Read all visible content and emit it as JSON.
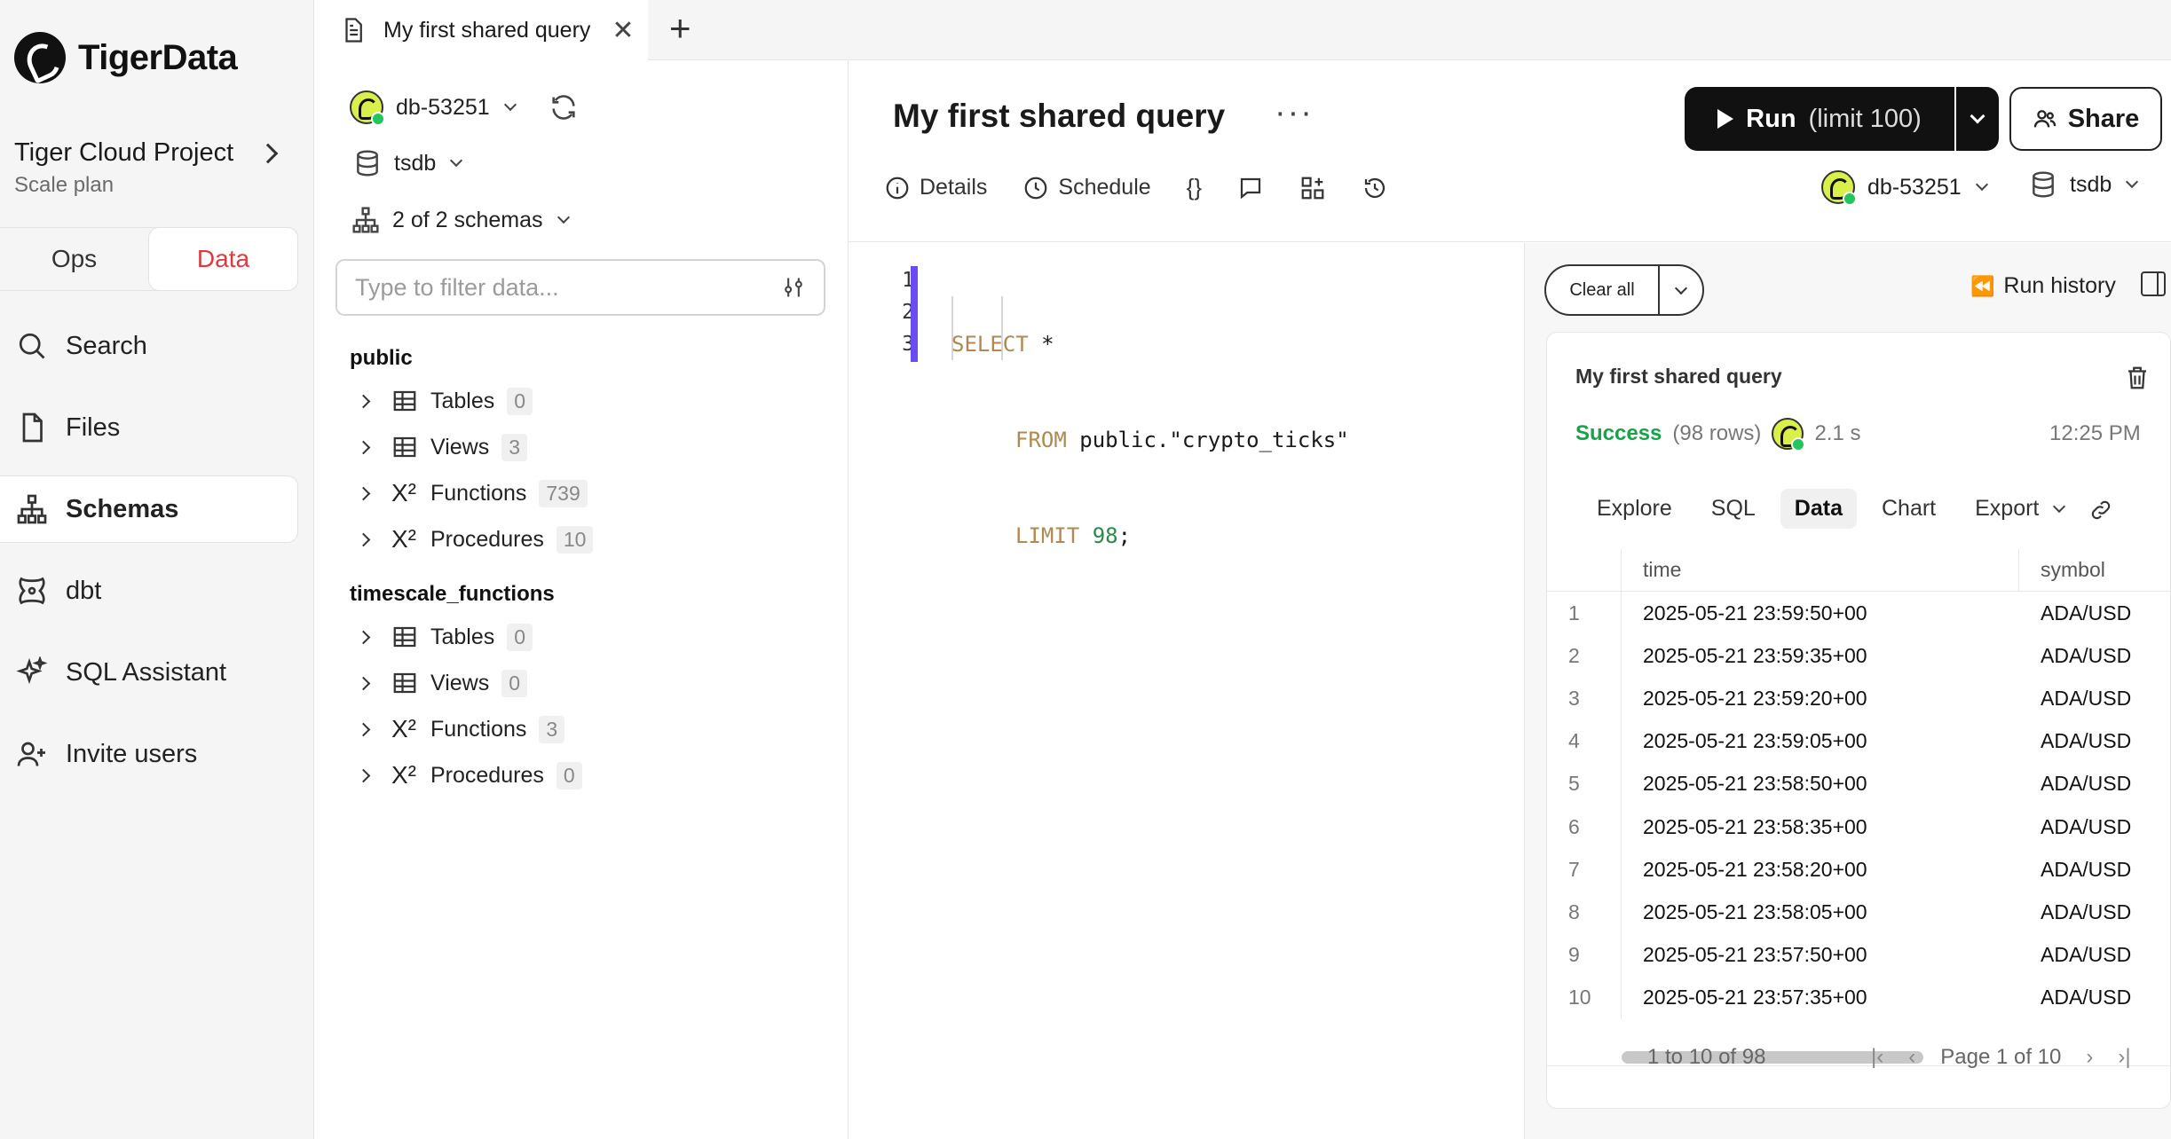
{
  "brand": {
    "name": "TigerData"
  },
  "project": {
    "name": "Tiger Cloud Project",
    "plan": "Scale plan"
  },
  "mode_toggle": {
    "ops": "Ops",
    "data": "Data",
    "active": "Data"
  },
  "nav": {
    "items": [
      {
        "label": "Search",
        "icon": "search-icon",
        "active": false
      },
      {
        "label": "Files",
        "icon": "file-icon",
        "active": false
      },
      {
        "label": "Schemas",
        "icon": "sitemap-icon",
        "active": true
      },
      {
        "label": "dbt",
        "icon": "dbt-icon",
        "active": false
      },
      {
        "label": "SQL Assistant",
        "icon": "sparkles-icon",
        "active": false
      },
      {
        "label": "Invite users",
        "icon": "user-plus-icon",
        "active": false
      }
    ]
  },
  "tabs": [
    {
      "label": "My first shared query",
      "active": true
    }
  ],
  "schema_panel": {
    "service": "db-53251",
    "database": "tsdb",
    "schemas_selected": "2 of 2 schemas",
    "filter_placeholder": "Type to filter data...",
    "groups": [
      {
        "name": "public",
        "items": [
          {
            "label": "Tables",
            "count": "0",
            "icon": "table-icon"
          },
          {
            "label": "Views",
            "count": "3",
            "icon": "table-icon"
          },
          {
            "label": "Functions",
            "count": "739",
            "icon": "function-icon"
          },
          {
            "label": "Procedures",
            "count": "10",
            "icon": "function-icon"
          }
        ]
      },
      {
        "name": "timescale_functions",
        "items": [
          {
            "label": "Tables",
            "count": "0",
            "icon": "table-icon"
          },
          {
            "label": "Views",
            "count": "0",
            "icon": "table-icon"
          },
          {
            "label": "Functions",
            "count": "3",
            "icon": "function-icon"
          },
          {
            "label": "Procedures",
            "count": "0",
            "icon": "function-icon"
          }
        ]
      }
    ]
  },
  "query": {
    "title": "My first shared query",
    "run_label": "Run",
    "run_limit": "(limit 100)",
    "share_label": "Share",
    "tools": {
      "details": "Details",
      "schedule": "Schedule"
    },
    "service": "db-53251",
    "database": "tsdb"
  },
  "editor": {
    "line_numbers": [
      "1",
      "2",
      "3"
    ],
    "lines": [
      {
        "kw": "SELECT",
        "rest": " *"
      },
      {
        "kw": "FROM",
        "rest": " public.\"crypto_ticks\""
      },
      {
        "kw": "LIMIT",
        "num": " 98",
        "rest": ";"
      }
    ]
  },
  "results": {
    "clear_all": "Clear all",
    "run_history": "Run history",
    "card": {
      "title": "My first shared query",
      "status": "Success",
      "rows": "(98 rows)",
      "duration": "2.1 s",
      "time": "12:25 PM"
    },
    "tabs": [
      "Explore",
      "SQL",
      "Data",
      "Chart",
      "Export"
    ],
    "active_tab": "Data",
    "columns": [
      "time",
      "symbol"
    ],
    "rows": [
      [
        "1",
        "2025-05-21 23:59:50+00",
        "ADA/USD"
      ],
      [
        "2",
        "2025-05-21 23:59:35+00",
        "ADA/USD"
      ],
      [
        "3",
        "2025-05-21 23:59:20+00",
        "ADA/USD"
      ],
      [
        "4",
        "2025-05-21 23:59:05+00",
        "ADA/USD"
      ],
      [
        "5",
        "2025-05-21 23:58:50+00",
        "ADA/USD"
      ],
      [
        "6",
        "2025-05-21 23:58:35+00",
        "ADA/USD"
      ],
      [
        "7",
        "2025-05-21 23:58:20+00",
        "ADA/USD"
      ],
      [
        "8",
        "2025-05-21 23:58:05+00",
        "ADA/USD"
      ],
      [
        "9",
        "2025-05-21 23:57:50+00",
        "ADA/USD"
      ],
      [
        "10",
        "2025-05-21 23:57:35+00",
        "ADA/USD"
      ]
    ],
    "pagination": {
      "range": "1 to 10 of 98",
      "page": "Page 1 of 10"
    }
  },
  "colors": {
    "accent": "#e0393e",
    "success": "#16a34a",
    "gutter_bar": "#6b4bf2",
    "run_button": "#111111"
  }
}
